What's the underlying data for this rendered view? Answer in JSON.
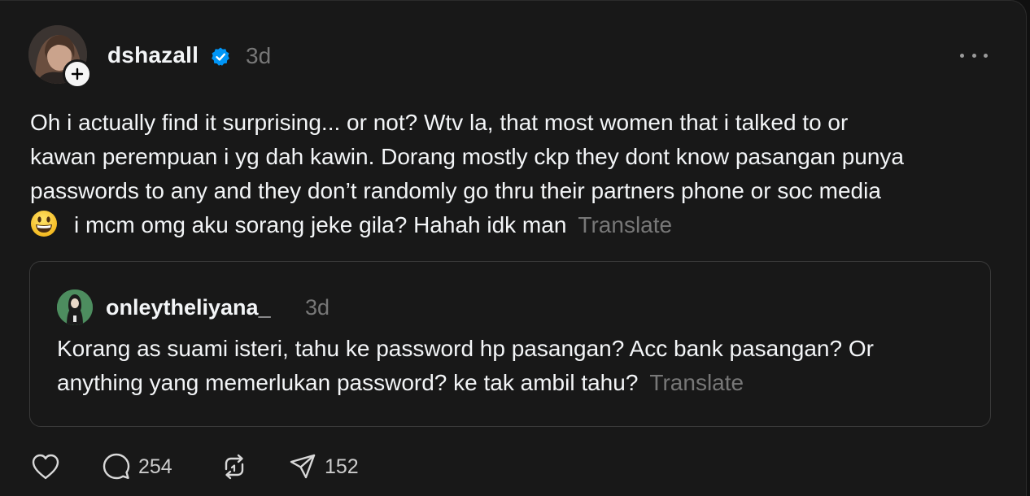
{
  "post": {
    "author": "dshazall",
    "time": "3d",
    "text_lines": [
      "Oh i actually find it surprising... or not? Wtv la, that most women that i talked to or",
      "kawan perempuan i yg dah kawin. Dorang mostly ckp they dont know pasangan punya",
      "passwords to any and they don’t randomly go thru their partners phone or soc media",
      "i mcm omg aku sorang jeke gila? Hahah idk man"
    ],
    "translate_label": "Translate"
  },
  "quote": {
    "author": "onleytheliyana_",
    "time": "3d",
    "text_lines": [
      "Korang as suami isteri, tahu ke password hp pasangan? Acc bank pasangan? Or",
      "anything yang memerlukan password? ke tak ambil tahu?"
    ],
    "translate_label": "Translate"
  },
  "actions": {
    "like_count": "",
    "reply_count": "254",
    "repost_count": "",
    "share_count": "152"
  },
  "icons": {
    "avatar": "avatar-photo",
    "follow": "plus-icon",
    "verified": "verified-badge-icon",
    "more": "more-dots-icon",
    "emoji": "grinning-face-emoji",
    "like": "heart-icon",
    "reply": "speech-bubble-icon",
    "repost": "repost-arrows-icon",
    "share": "paper-plane-icon"
  },
  "colors": {
    "background": "#181818",
    "text": "#f3f5f7",
    "muted": "#777777",
    "verified": "#0095f6"
  }
}
